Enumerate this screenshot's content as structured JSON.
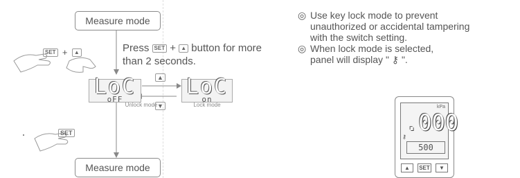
{
  "flow": {
    "top_mode": "Measure mode",
    "bottom_mode": "Measure mode",
    "combo_set": "SET",
    "combo_plus": "+",
    "combo_up": "▲",
    "instruction_prefix": "Press",
    "instruction_key_set": "SET",
    "instruction_plus": "+",
    "instruction_key_up": "▲",
    "instruction_suffix": "button for more",
    "instruction_line2": "than 2 seconds.",
    "lock_switch_up": "▲",
    "lock_switch_down": "▼",
    "unlock_display_top": "LoC",
    "unlock_display_bottom": "oFF",
    "unlock_label": "Unlock mode",
    "lock_display_top": "LoC",
    "lock_display_bottom": "on",
    "lock_label": "Lock mode",
    "exit_key": "SET"
  },
  "notes": [
    {
      "bullet": "◎",
      "lines": [
        "Use key lock mode to prevent",
        "unauthorized or accidental tampering",
        "with the switch setting."
      ]
    },
    {
      "bullet": "◎",
      "lines": [
        "When lock mode is selected,",
        "panel will display \" ⚷ \"."
      ]
    }
  ],
  "panel": {
    "unit": "kPa",
    "main_value": ".000",
    "lock_symbol": "⚷",
    "sub_value": "500",
    "keys": [
      "▲",
      "SET",
      "▼"
    ]
  },
  "colors": {
    "line": "#8a8a8a",
    "text": "#555555"
  },
  "icons": [
    "hand-pointer-icon",
    "arrow-icon"
  ]
}
